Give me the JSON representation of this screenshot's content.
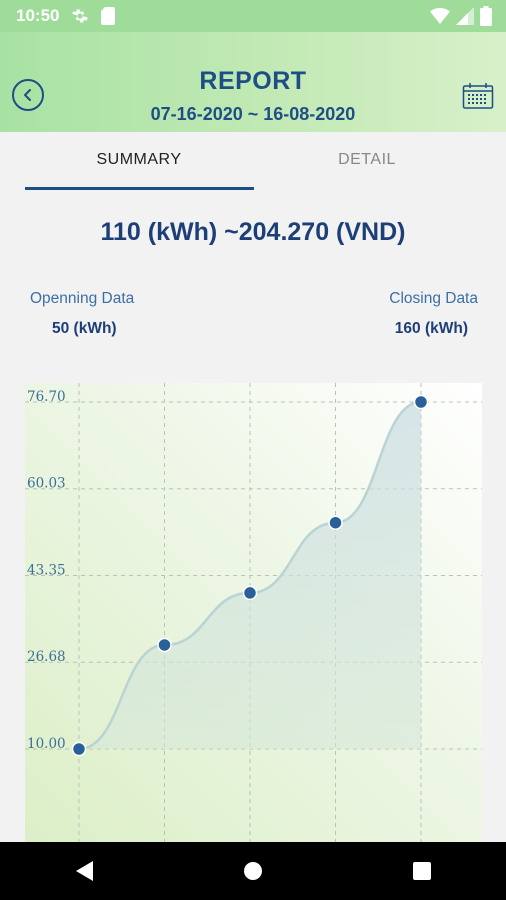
{
  "status_bar": {
    "time": "10:50",
    "icons": [
      "settings-gear-icon",
      "sim-card-icon",
      "wifi-icon",
      "cell-signal-icon",
      "battery-icon"
    ]
  },
  "header": {
    "title": "REPORT",
    "date_range": "07-16-2020 ~ 16-08-2020",
    "back_icon": "back-arrow-icon",
    "calendar_icon": "calendar-icon"
  },
  "tabs": [
    {
      "label": "SUMMARY",
      "active": true
    },
    {
      "label": "DETAIL",
      "active": false
    }
  ],
  "summary": {
    "total": "110 (kWh) ~204.270 (VND)",
    "opening_label": "Openning Data",
    "opening_value": "50 (kWh)",
    "closing_label": "Closing Data",
    "closing_value": "160 (kWh)"
  },
  "chart_data": {
    "type": "line",
    "x": [
      1,
      2,
      3,
      4,
      5
    ],
    "values": [
      10.0,
      30.0,
      40.0,
      53.5,
      76.7
    ],
    "y_ticks": [
      "10.00",
      "26.68",
      "43.35",
      "60.03",
      "76.70"
    ],
    "ylim": [
      10.0,
      76.7
    ],
    "grid": true,
    "smooth": true,
    "area_fill": true,
    "line_color": "#b9d4d3",
    "point_color": "#2a6099"
  },
  "nav_bar": {
    "icons": [
      "back-triangle-icon",
      "home-circle-icon",
      "recents-square-icon"
    ]
  },
  "colors": {
    "primary": "#1d4f86",
    "status_bar": "#9fdc9a",
    "header_start": "#a8e2a3",
    "header_end": "#d8f0c9"
  }
}
